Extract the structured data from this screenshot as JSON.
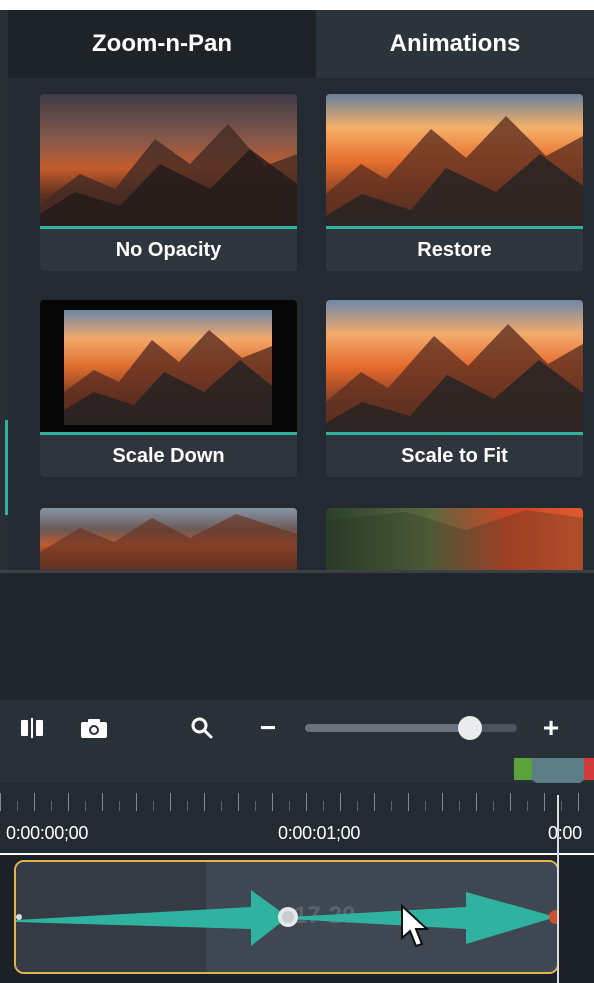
{
  "tabs": {
    "zoom_n_pan": "Zoom-n-Pan",
    "animations": "Animations"
  },
  "animations": [
    {
      "label": "No Opacity"
    },
    {
      "label": "Restore"
    },
    {
      "label": "Scale Down"
    },
    {
      "label": "Scale to Fit"
    }
  ],
  "toolbar": {
    "split_icon": "split-icon",
    "snapshot_icon": "camera-icon",
    "search_icon": "search-icon",
    "zoom_minus": "−",
    "zoom_plus": "+",
    "zoom_value": 0.78
  },
  "timeline": {
    "times": [
      "0:00:00;00",
      "0:00:01;00",
      "0:00"
    ],
    "clip_text": "-17-20..."
  },
  "colors": {
    "accent": "#2fb3a0",
    "clip_border": "#e0b44c"
  }
}
